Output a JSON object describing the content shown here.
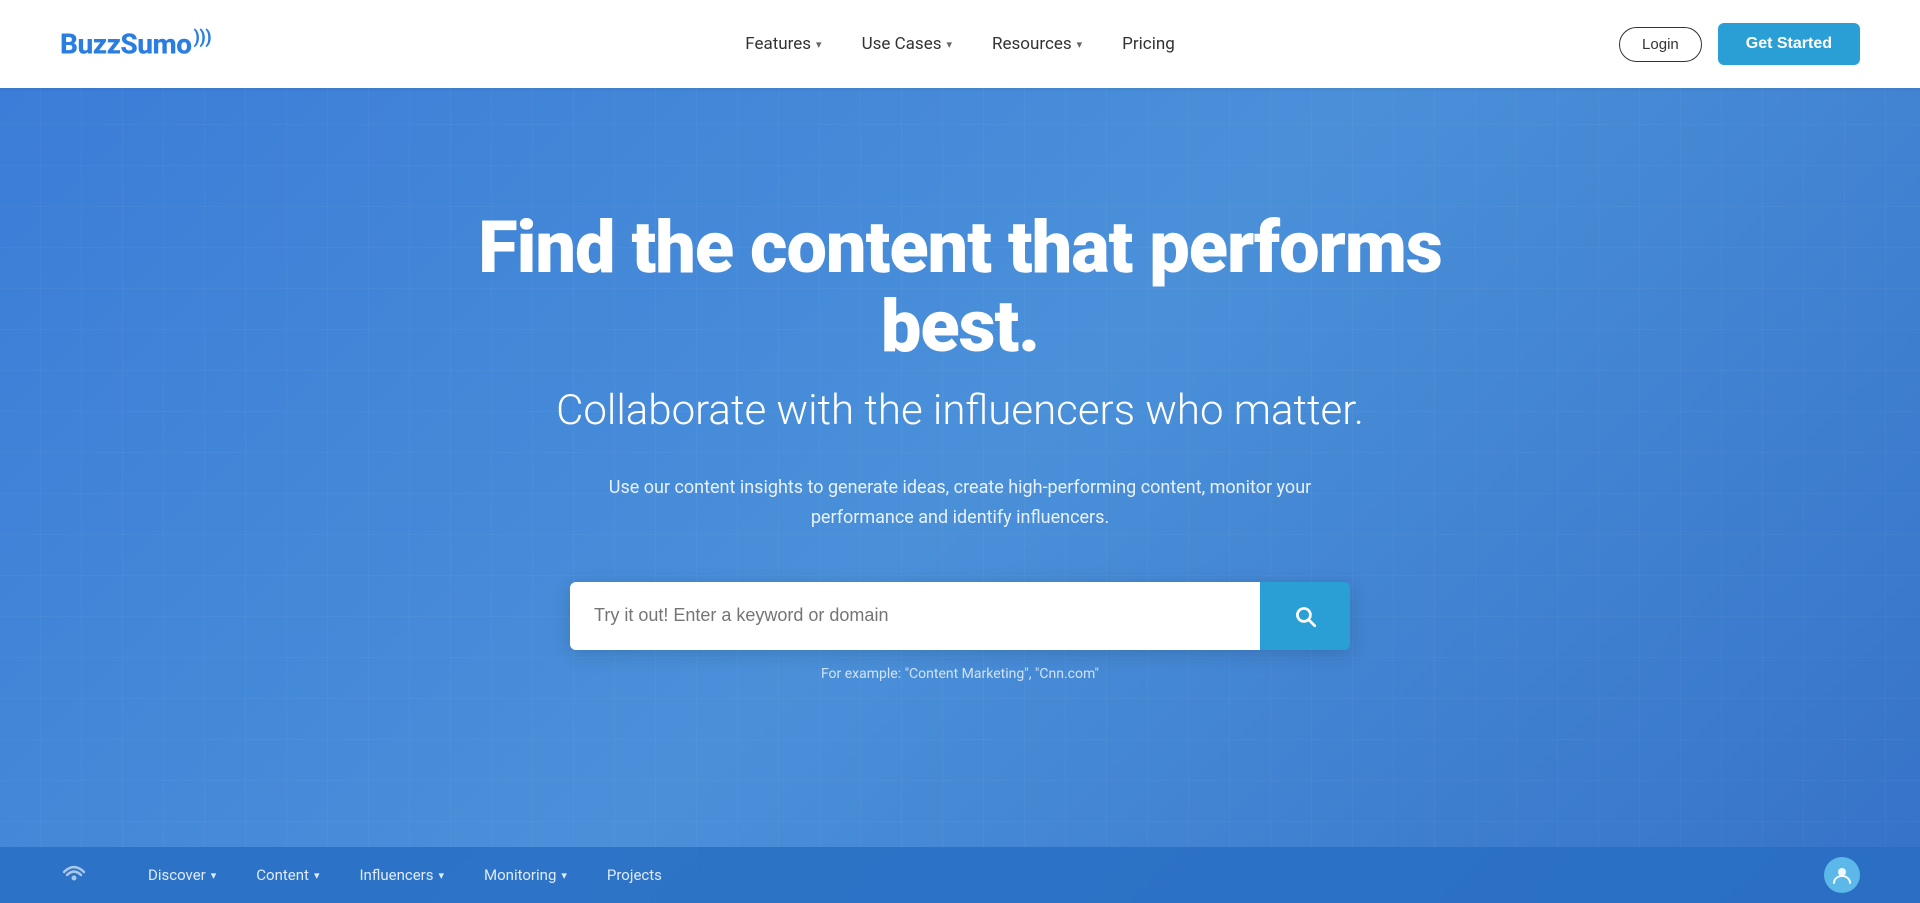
{
  "brand": {
    "name": "BuzzSumo",
    "wifi_symbol": "📶"
  },
  "navbar": {
    "logo": "BuzzSumo",
    "nav_items": [
      {
        "label": "Features",
        "has_dropdown": true
      },
      {
        "label": "Use Cases",
        "has_dropdown": true
      },
      {
        "label": "Resources",
        "has_dropdown": true
      },
      {
        "label": "Pricing",
        "has_dropdown": false
      }
    ],
    "login_label": "Login",
    "get_started_label": "Get Started"
  },
  "hero": {
    "headline": "Find the content that performs best.",
    "subheadline": "Collaborate with the influencers who matter.",
    "description": "Use our content insights to generate ideas, create high-performing content, monitor your performance and identify influencers.",
    "search_placeholder": "Try it out! Enter a keyword or domain",
    "search_hint": "For example: \"Content Marketing\", \"Cnn.com\"",
    "search_button_label": "Search"
  },
  "app_nav": {
    "items": [
      {
        "label": "Discover",
        "has_dropdown": true
      },
      {
        "label": "Content",
        "has_dropdown": true
      },
      {
        "label": "Influencers",
        "has_dropdown": true
      },
      {
        "label": "Monitoring",
        "has_dropdown": true
      },
      {
        "label": "Projects",
        "has_dropdown": false
      }
    ]
  },
  "colors": {
    "brand_blue": "#2a7de1",
    "hero_bg": "#3b7dd8",
    "cta_blue": "#2a9fd6",
    "white": "#ffffff"
  }
}
